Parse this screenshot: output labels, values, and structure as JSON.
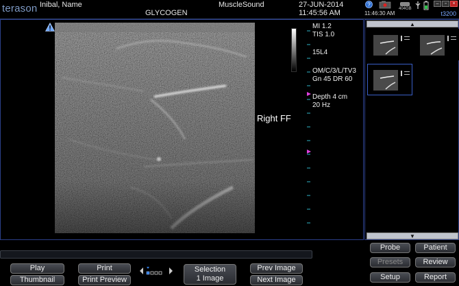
{
  "header": {
    "brand": "terason",
    "patient_name": "Inibal, Name",
    "study": "GLYCOGEN",
    "institution": "MuscleSound",
    "date": "27-JUN-2014",
    "time": "11:45:56 AM"
  },
  "system": {
    "clock": "11:46:30 AM",
    "model": "t3200",
    "disk": "404GB"
  },
  "imaging_params": {
    "mi": "MI  1.2",
    "tis": "TIS 1.0",
    "probe": "15L4",
    "preset": "OM/C/3/L/TV3",
    "gain": "Gn 45   DR 60",
    "depth": "Depth 4 cm",
    "frame_rate": "20 Hz"
  },
  "annotation": "Right FF",
  "buttons": {
    "play": "Play",
    "thumbnail": "Thumbnail",
    "print": "Print",
    "print_preview": "Print Preview",
    "selection_line1": "Selection",
    "selection_line2": "1 Image",
    "prev_image": "Prev Image",
    "next_image": "Next Image",
    "probe": "Probe",
    "patient": "Patient",
    "presets": "Presets",
    "review": "Review",
    "setup": "Setup",
    "report": "Report"
  },
  "colors": {
    "accent": "#7f9bc6",
    "panel_border": "#2b3f88",
    "model_text": "#7aa7ff",
    "focus_marker": "#e040e0"
  },
  "icons": {
    "warning": "warning-triangle-icon",
    "scroll_up": "triangle-up-icon",
    "scroll_down": "triangle-down-icon"
  }
}
